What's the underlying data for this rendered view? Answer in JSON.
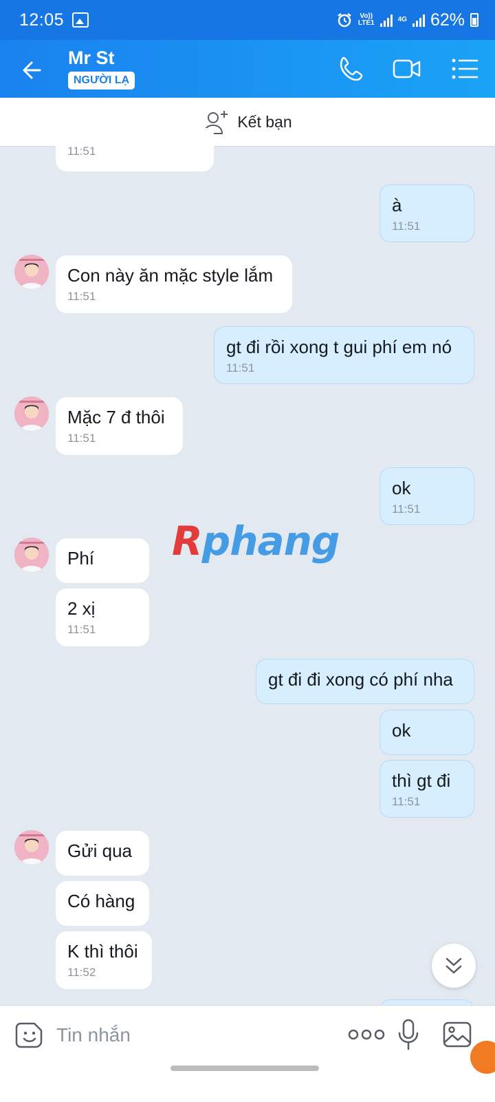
{
  "status_bar": {
    "time": "12:05",
    "network_1": "Vo))\nLTE1",
    "network_2": "4G",
    "battery": "62%"
  },
  "header": {
    "contact_name": "Mr St",
    "badge": "NGƯỜI LẠ"
  },
  "friend_bar": {
    "label": "Kết bạn"
  },
  "messages": [
    {
      "dir": "in",
      "text": "",
      "time": "11:51"
    },
    {
      "dir": "out",
      "text": "à",
      "time": "11:51"
    },
    {
      "dir": "in",
      "text": "Con này ăn mặc style lắm",
      "time": "11:51"
    },
    {
      "dir": "out",
      "text": "gt đi rồi xong t gui phí em nó",
      "time": "11:51"
    },
    {
      "dir": "in",
      "text": "Mặc 7 đ thôi",
      "time": "11:51"
    },
    {
      "dir": "out",
      "text": "ok",
      "time": "11:51"
    },
    {
      "dir": "in",
      "text": "Phí",
      "time": ""
    },
    {
      "dir": "in",
      "text": "2 xị",
      "time": "11:51"
    },
    {
      "dir": "out",
      "text": "gt đi đi xong có phí nha",
      "time": ""
    },
    {
      "dir": "out",
      "text": "ok",
      "time": ""
    },
    {
      "dir": "out",
      "text": "thì gt đi",
      "time": "11:51"
    },
    {
      "dir": "in",
      "text": "Gửi qua",
      "time": ""
    },
    {
      "dir": "in",
      "text": "Có hàng",
      "time": ""
    },
    {
      "dir": "in",
      "text": "K thì thôi",
      "time": "11:52"
    }
  ],
  "watermark": {
    "first": "R",
    "rest": "phang"
  },
  "input": {
    "placeholder": "Tin nhắn"
  },
  "colors": {
    "header": "#1a82ee",
    "outgoing_bubble": "#d6eefd",
    "incoming_bubble": "#ffffff",
    "background": "#e2e9f1"
  }
}
